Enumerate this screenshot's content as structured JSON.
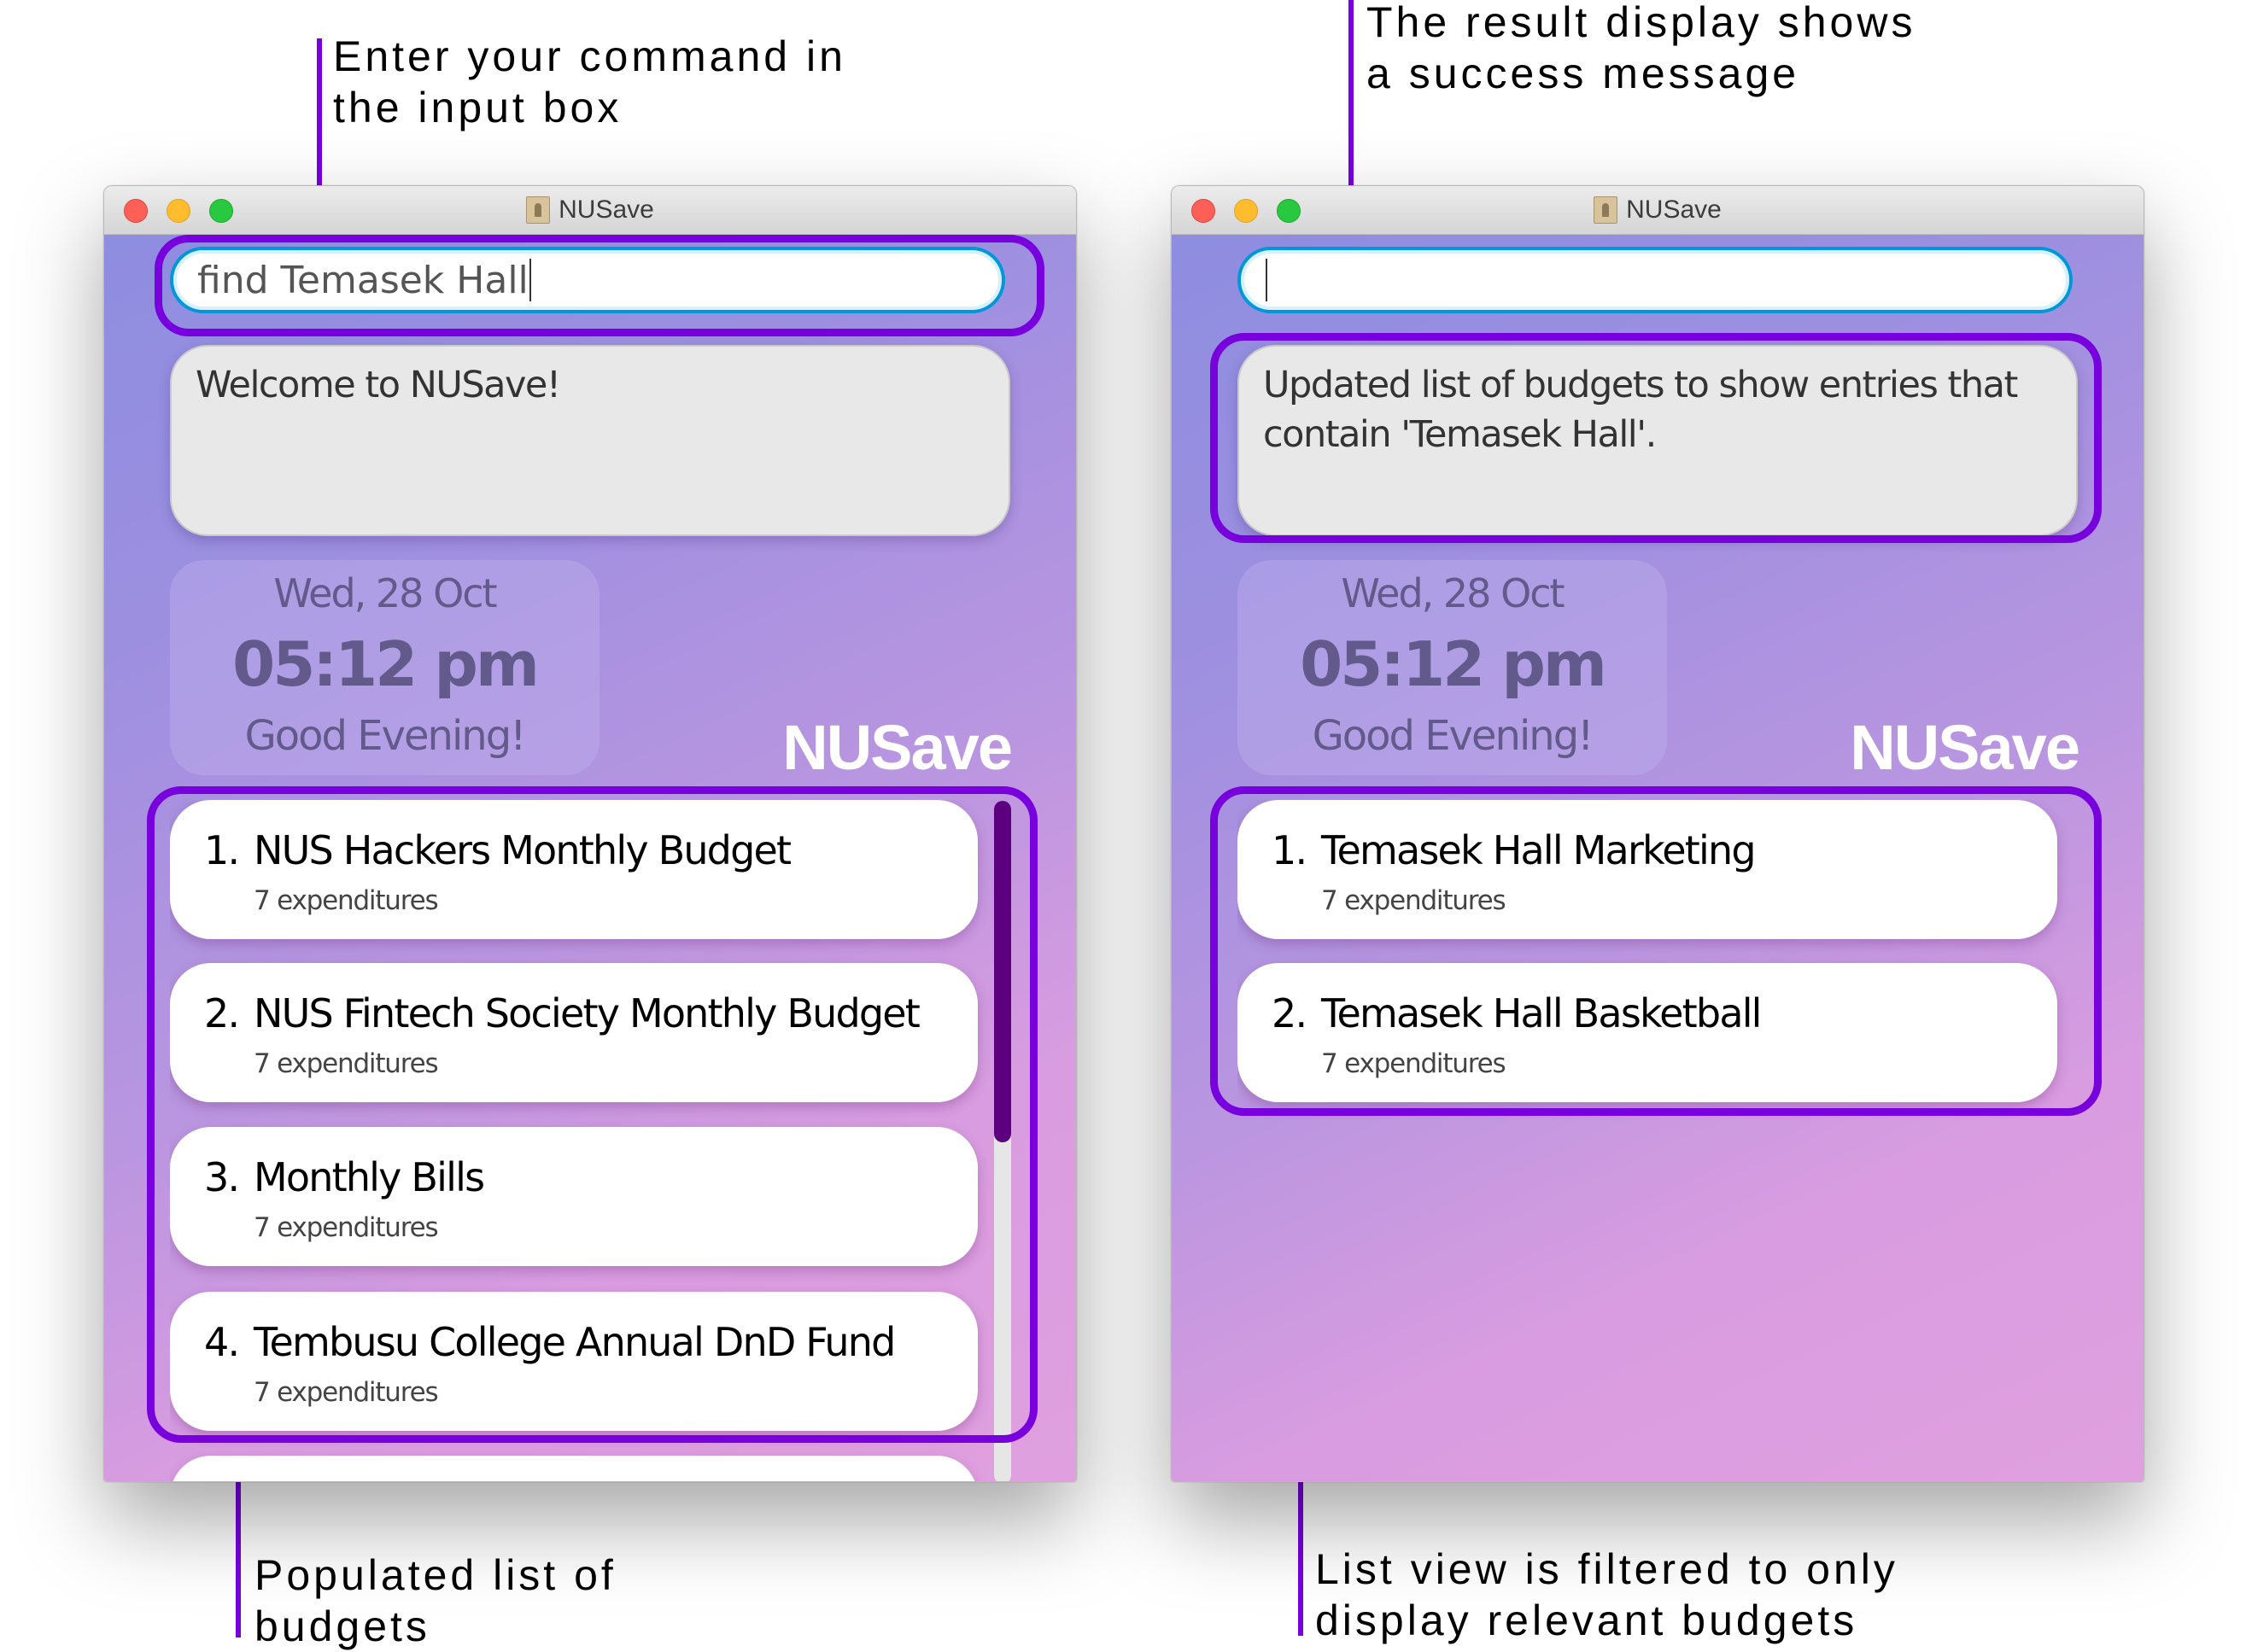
{
  "annotations": {
    "input_box": [
      "Enter your command in",
      "the input box"
    ],
    "result_display": [
      "The result display shows",
      "a success message"
    ],
    "populated_list": [
      "Populated list of",
      "budgets"
    ],
    "filtered_list": [
      "List view is filtered to only",
      "display relevant budgets"
    ]
  },
  "colors": {
    "highlight": "#7700dd",
    "scroll_thumb": "#5c0080",
    "input_border": "#0097d8",
    "brand_text": "#ffffff"
  },
  "windows": [
    {
      "title": "NUSave",
      "app_icon": "contacts-book-icon",
      "command_input": {
        "value": "find Temasek Hall",
        "placeholder": ""
      },
      "result_display": "Welcome to NUSave!",
      "clock": {
        "date": "Wed, 28 Oct",
        "time": "05:12 pm",
        "greeting": "Good Evening!"
      },
      "brand": "NUSave",
      "scroll_position": {
        "visible_fraction": 0.5,
        "offset_fraction": 0.0
      },
      "budgets": [
        {
          "index": "1.",
          "name": "NUS Hackers Monthly Budget",
          "expenditures": "7 expenditures"
        },
        {
          "index": "2.",
          "name": "NUS Fintech Society Monthly Budget",
          "expenditures": "7 expenditures"
        },
        {
          "index": "3.",
          "name": "Monthly Bills",
          "expenditures": "7 expenditures"
        },
        {
          "index": "4.",
          "name": "Tembusu College Annual DnD Fund",
          "expenditures": "7 expenditures"
        },
        {
          "index": "",
          "name": "",
          "expenditures": ""
        }
      ]
    },
    {
      "title": "NUSave",
      "app_icon": "contacts-book-icon",
      "command_input": {
        "value": "",
        "placeholder": ""
      },
      "result_display": "Updated list of budgets to show entries that contain 'Temasek Hall'.",
      "clock": {
        "date": "Wed, 28 Oct",
        "time": "05:12 pm",
        "greeting": "Good Evening!"
      },
      "brand": "NUSave",
      "budgets": [
        {
          "index": "1.",
          "name": "Temasek Hall Marketing",
          "expenditures": "7 expenditures"
        },
        {
          "index": "2.",
          "name": "Temasek Hall Basketball",
          "expenditures": "7 expenditures"
        }
      ]
    }
  ]
}
